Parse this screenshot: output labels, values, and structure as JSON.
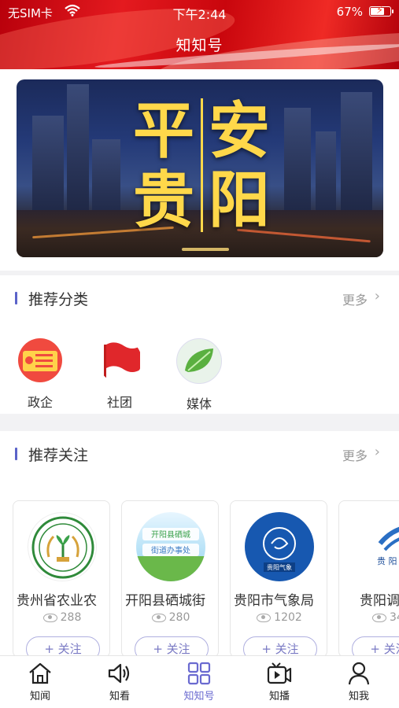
{
  "status_bar": {
    "carrier": "无SIM卡",
    "time": "下午2:44",
    "battery": "67%"
  },
  "header": {
    "title": "知知号"
  },
  "banner": {
    "lines": [
      "平安",
      "贵阳"
    ],
    "chars": [
      "平",
      "安",
      "贵",
      "阳"
    ]
  },
  "recommended_categories": {
    "title": "推荐分类",
    "more": "更多",
    "items": [
      {
        "label": "政企",
        "icon": "party-flag-icon"
      },
      {
        "label": "社团",
        "icon": "red-flag-icon"
      },
      {
        "label": "媒体",
        "icon": "leaf-icon"
      }
    ]
  },
  "recommended_follows": {
    "title": "推荐关注",
    "more": "更多",
    "follow_label": "+ 关注",
    "items": [
      {
        "name": "贵州省农业农",
        "views": "288"
      },
      {
        "name": "开阳县硒城街",
        "views": "280",
        "logo_text": [
          "开阳县硒城",
          "街道办事处"
        ]
      },
      {
        "name": "贵阳市气象局",
        "views": "1202",
        "logo_text": "贵阳气象"
      },
      {
        "name": "贵阳调",
        "views": "34",
        "logo_text": "贵 阳 调"
      }
    ]
  },
  "tabbar": {
    "active_index": 2,
    "items": [
      {
        "label": "知闻",
        "icon": "home-icon"
      },
      {
        "label": "知看",
        "icon": "speaker-icon"
      },
      {
        "label": "知知号",
        "icon": "grid-icon"
      },
      {
        "label": "知播",
        "icon": "tv-play-icon"
      },
      {
        "label": "知我",
        "icon": "person-icon"
      }
    ]
  },
  "colors": {
    "header_red": "#e41a1f",
    "accent_purple": "#6a6ad0",
    "banner_yellow": "#ffd84a"
  }
}
